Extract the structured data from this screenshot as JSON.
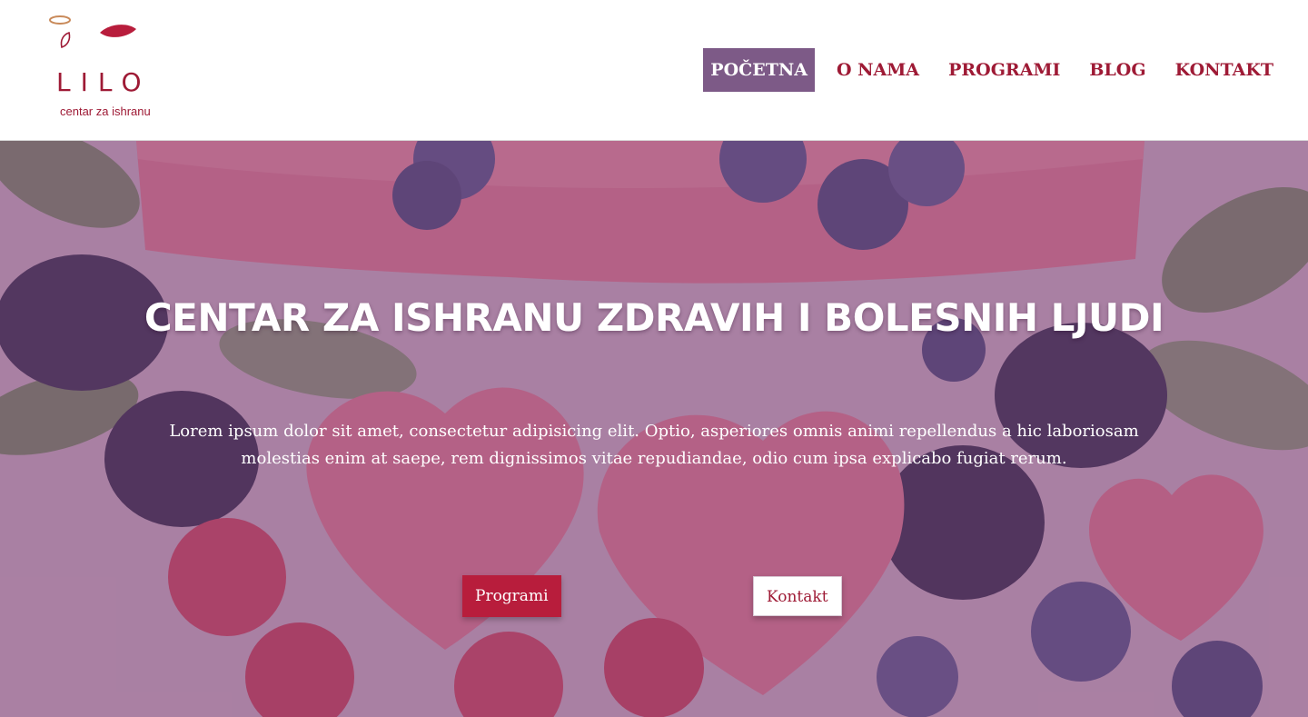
{
  "header": {
    "logo_text": "LILO",
    "logo_tagline": "centar za ishranu",
    "nav": [
      {
        "label": "POČETNA",
        "active": true
      },
      {
        "label": "O NAMA",
        "active": false
      },
      {
        "label": "PROGRAMI",
        "active": false
      },
      {
        "label": "BLOG",
        "active": false
      },
      {
        "label": "KONTAKT",
        "active": false
      }
    ]
  },
  "hero": {
    "title": "CENTAR ZA ISHRANU ZDRAVIH I BOLESNIH LJUDI",
    "text": "Lorem ipsum dolor sit amet, consectetur adipisicing elit. Optio, asperiores omnis animi repellendus a hic laboriosam molestias enim at saepe, rem dignissimos vitae repudiandae, odio cum ipsa explicabo fugiat rerum.",
    "buttons": {
      "primary": "Programi",
      "secondary": "Kontakt"
    },
    "background_icon": "fruit-background-image"
  },
  "colors": {
    "brand": "#9e1a35",
    "nav_active": "#7d5a87",
    "button_primary": "#b81d3c",
    "overlay": "#7a4678"
  }
}
